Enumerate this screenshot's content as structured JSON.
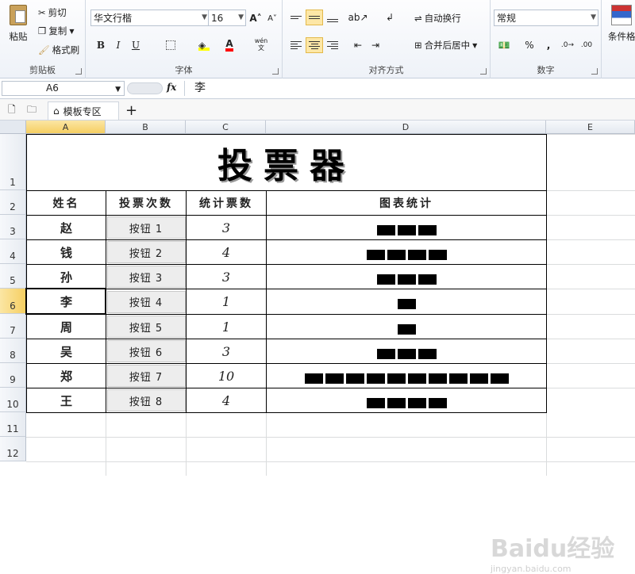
{
  "ribbon": {
    "clipboard": {
      "paste": "粘贴",
      "cut": "剪切",
      "copy": "复制",
      "format_painter": "格式刷",
      "group": "剪贴板"
    },
    "font": {
      "name": "华文行楷",
      "size": "16",
      "bold": "B",
      "italic": "I",
      "underline": "U",
      "grow": "A˄",
      "shrink": "A˅",
      "wen": "wén\n文",
      "group": "字体"
    },
    "alignment": {
      "wrap": "自动换行",
      "merge": "合并后居中",
      "group": "对齐方式"
    },
    "number": {
      "format": "常规",
      "percent": "%",
      "comma": ",",
      "group": "数字"
    },
    "styles": {
      "conditional": "条件格"
    }
  },
  "formula_bar": {
    "name_box": "A6",
    "fx": "fx",
    "value": "李"
  },
  "tabs": {
    "template": "模板专区",
    "add": "+"
  },
  "columns": [
    "A",
    "B",
    "C",
    "D",
    "E"
  ],
  "rows": [
    "1",
    "2",
    "3",
    "4",
    "5",
    "6",
    "7",
    "8",
    "9",
    "10",
    "11",
    "12"
  ],
  "sheet": {
    "title": "投票器",
    "headers": [
      "姓名",
      "投票次数",
      "统计票数",
      "图表统计"
    ],
    "records": [
      {
        "name": "赵",
        "button": "按钮 1",
        "count": "3",
        "votes": 3
      },
      {
        "name": "钱",
        "button": "按钮 2",
        "count": "4",
        "votes": 4
      },
      {
        "name": "孙",
        "button": "按钮 3",
        "count": "3",
        "votes": 3
      },
      {
        "name": "李",
        "button": "按钮 4",
        "count": "1",
        "votes": 1
      },
      {
        "name": "周",
        "button": "按钮 5",
        "count": "1",
        "votes": 1
      },
      {
        "name": "吴",
        "button": "按钮 6",
        "count": "3",
        "votes": 3
      },
      {
        "name": "郑",
        "button": "按钮 7",
        "count": "10",
        "votes": 10
      },
      {
        "name": "王",
        "button": "按钮 8",
        "count": "4",
        "votes": 4
      }
    ]
  },
  "watermark": {
    "brand": "Baidu经验",
    "url": "jingyan.baidu.com"
  },
  "colors": {
    "selected_header": "#f6cf62",
    "ribbon_bg": "#eef2f8",
    "bar": "#000000"
  }
}
